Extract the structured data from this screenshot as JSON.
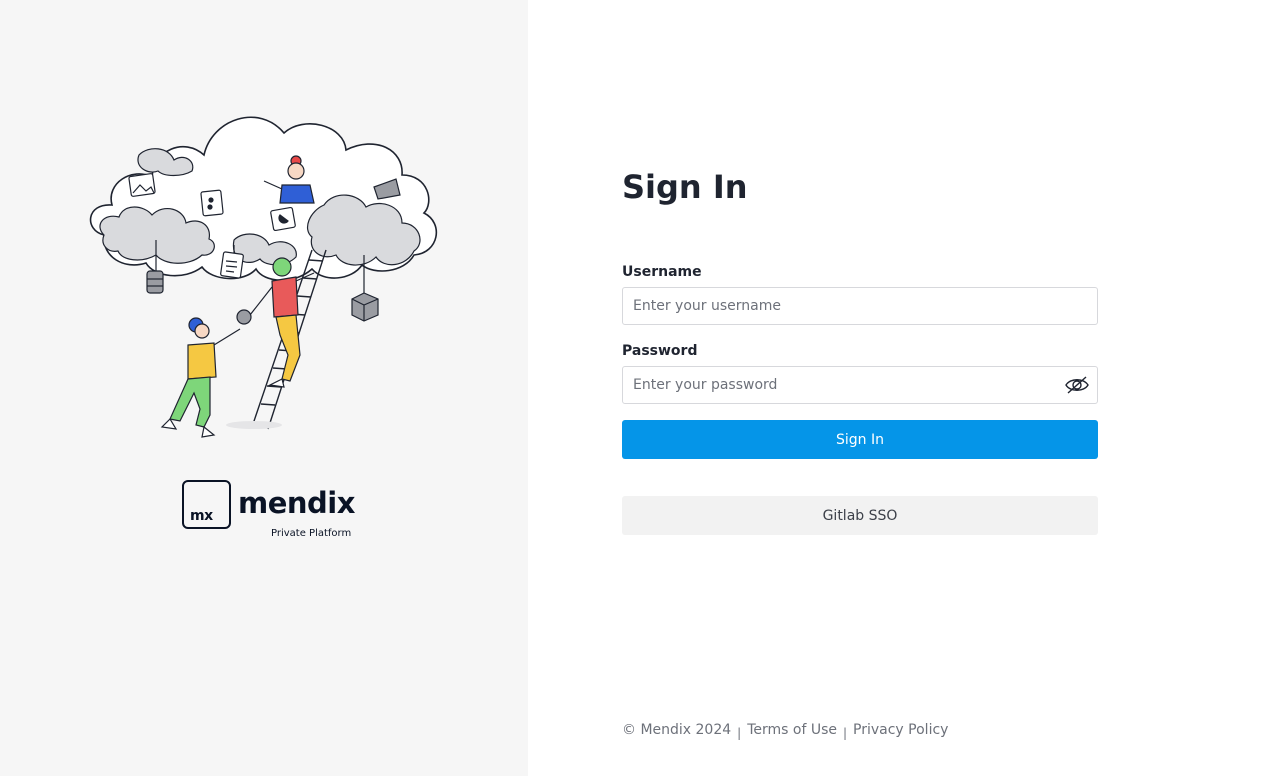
{
  "brand": {
    "logo_box_text": "mx",
    "logo_word": "mendix",
    "logo_subtitle": "Private Platform"
  },
  "form": {
    "title": "Sign In",
    "username": {
      "label": "Username",
      "placeholder": "Enter your username",
      "value": ""
    },
    "password": {
      "label": "Password",
      "placeholder": "Enter your password",
      "value": "",
      "toggle_icon": "eye-slash-icon"
    },
    "submit_label": "Sign In",
    "sso_label": "Gitlab SSO"
  },
  "footer": {
    "copyright": "© Mendix 2024",
    "separator": "|",
    "terms_label": "Terms of Use",
    "privacy_label": "Privacy Policy"
  },
  "colors": {
    "left_panel_bg": "#f6f6f6",
    "primary": "#0595e8",
    "secondary_button_bg": "#f2f2f2",
    "text_dark": "#1f2430",
    "text_muted": "#6d717a"
  }
}
